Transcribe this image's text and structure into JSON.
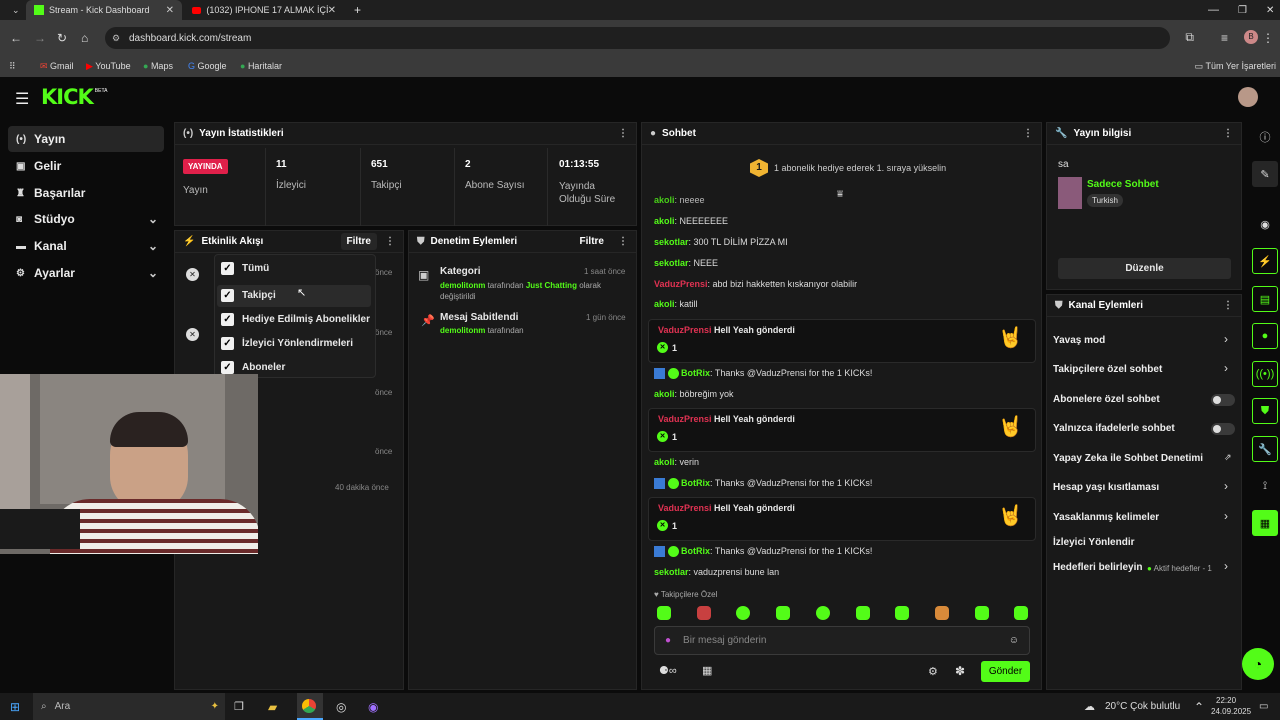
{
  "browser": {
    "tabs": [
      {
        "label": "Stream - Kick Dashboard"
      },
      {
        "label": "(1032) IPHONE 17 ALMAK İÇİN"
      }
    ],
    "url": "dashboard.kick.com/stream",
    "bookmarks": [
      "Gmail",
      "YouTube",
      "Maps",
      "Google",
      "Haritalar"
    ],
    "all_bookmarks": "Tüm Yer İşaretleri",
    "profile_initial": "B"
  },
  "brand": {
    "logo": "KICK",
    "badge": "BETA",
    "accent": "#53fc18"
  },
  "sidebar": {
    "items": [
      {
        "label": "Yayın",
        "icon": "broadcast-icon"
      },
      {
        "label": "Gelir",
        "icon": "wallet-icon"
      },
      {
        "label": "Başarılar",
        "icon": "trophy-icon"
      },
      {
        "label": "Stüdyo",
        "icon": "studio-icon"
      },
      {
        "label": "Kanal",
        "icon": "channel-icon"
      },
      {
        "label": "Ayarlar",
        "icon": "gear-icon"
      }
    ]
  },
  "stats": {
    "title": "Yayın İstatistikleri",
    "live_badge": "YAYINDA",
    "live_label": "Yayın",
    "items": [
      {
        "value": "11",
        "label": "İzleyici"
      },
      {
        "value": "651",
        "label": "Takipçi"
      },
      {
        "value": "2",
        "label": "Abone Sayısı"
      },
      {
        "value": "01:13:55",
        "label": "Yayında Olduğu Süre"
      }
    ]
  },
  "activity": {
    "title": "Etkinlik Akışı",
    "filter_label": "Filtre",
    "times": [
      "önce",
      "önce",
      "önce",
      "önce",
      "40 dakika önce"
    ],
    "filter_options": [
      "Tümü",
      "Takipçi",
      "Hediye Edilmiş Abonelikler",
      "İzleyici Yönlendirmeleri",
      "Aboneler"
    ]
  },
  "moderation": {
    "title": "Denetim Eylemleri",
    "filter_label": "Filtre",
    "items": [
      {
        "title": "Kategori",
        "time": "1 saat önce",
        "user": "demolitonm",
        "text1": "tarafından",
        "category": "Just Chatting",
        "text2": "olarak değiştirildi"
      },
      {
        "title": "Mesaj Sabitlendi",
        "time": "1 gün önce",
        "user": "demolitonm",
        "text1": "tarafından"
      }
    ]
  },
  "chat": {
    "title": "Sohbet",
    "goal_badge": "1",
    "goal_text": "1 abonelik hediye ederek 1. sıraya yükselin",
    "messages": [
      {
        "user": "akoli",
        "text": "neeee"
      },
      {
        "user": "akoli",
        "text": "NEEEEEEE"
      },
      {
        "user": "sekotlar",
        "text": "300 TL DİLİM PİZZA MI"
      },
      {
        "user": "sekotlar",
        "text": "NEEE"
      },
      {
        "user": "VaduzPrensi",
        "text": "abd bizi hakketten kıskanıyor olabilir"
      },
      {
        "user": "akoli",
        "text": "katill"
      }
    ],
    "gift_cards": [
      {
        "user": "VaduzPrensi",
        "text": "Hell Yeah gönderdi",
        "count": "1"
      },
      {
        "user": "VaduzPrensi",
        "text": "Hell Yeah gönderdi",
        "count": "1"
      },
      {
        "user": "VaduzPrensi",
        "text": "Hell Yeah gönderdi",
        "count": "1"
      }
    ],
    "bot": {
      "user": "BotRix",
      "text": "Thanks @VaduzPrensi for the 1 KICKs!"
    },
    "msg_a": {
      "user": "akoli",
      "text": "böbreğim yok"
    },
    "msg_b": {
      "user": "akoli",
      "text": "verin"
    },
    "msg_c": {
      "user": "sekotlar",
      "text": "vaduzprensi bune lan"
    },
    "followers_only": "Takipçilere Özel",
    "input_placeholder": "Bir mesaj gönderin",
    "send_label": "Gönder"
  },
  "stream_info": {
    "title": "Yayın bilgisi",
    "stream_title": "sa",
    "category": "Sadece Sohbet",
    "language": "Turkish",
    "edit_label": "Düzenle"
  },
  "channel_actions": {
    "title": "Kanal Eylemleri",
    "items": [
      {
        "label": "Yavaş mod",
        "control": "chevron"
      },
      {
        "label": "Takipçilere özel sohbet",
        "control": "chevron"
      },
      {
        "label": "Abonelere özel sohbet",
        "control": "toggle"
      },
      {
        "label": "Yalnızca ifadelerle sohbet",
        "control": "toggle"
      },
      {
        "label": "Yapay Zeka ile Sohbet Denetimi",
        "control": "external"
      },
      {
        "label": "Hesap yaşı kısıtlaması",
        "control": "chevron"
      },
      {
        "label": "Yasaklanmış kelimeler",
        "control": "chevron"
      },
      {
        "label": "İzleyici Yönlendir",
        "control": "none"
      },
      {
        "label": "Hedefleri belirleyin",
        "control": "chevron"
      }
    ],
    "goals_status": "Aktif hedefler - 1"
  },
  "taskbar": {
    "search_placeholder": "Ara",
    "weather": "20°C Çok bulutlu",
    "time": "22:20",
    "date": "24.09.2025"
  }
}
